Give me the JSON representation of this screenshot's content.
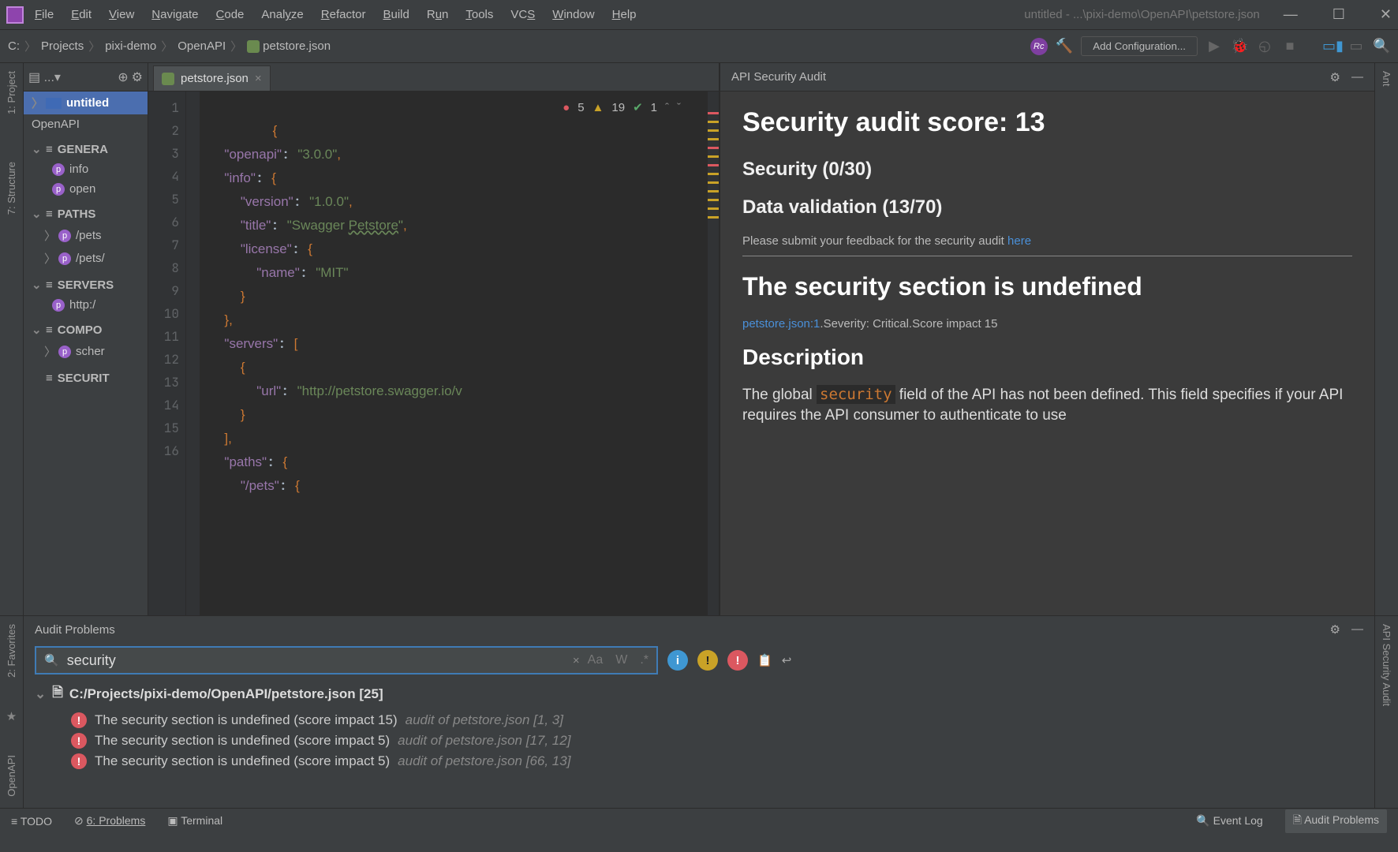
{
  "window": {
    "title": "untitled - ...\\pixi-demo\\OpenAPI\\petstore.json"
  },
  "menu": [
    "File",
    "Edit",
    "View",
    "Navigate",
    "Code",
    "Analyze",
    "Refactor",
    "Build",
    "Run",
    "Tools",
    "VCS",
    "Window",
    "Help"
  ],
  "breadcrumb": [
    "C:",
    "Projects",
    "pixi-demo",
    "OpenAPI",
    "petstore.json"
  ],
  "toolbar": {
    "config_label": "Add Configuration..."
  },
  "leftstrips": {
    "project": "1: Project",
    "structure": "7: Structure",
    "favorites": "2: Favorites",
    "openapi": "OpenAPI"
  },
  "rightstrips": {
    "ant": "Ant",
    "audit": "API Security Audit"
  },
  "tree": {
    "root": "untitled",
    "group1": "OpenAPI",
    "sections": {
      "general": {
        "label": "GENERA",
        "items": [
          "info",
          "open"
        ]
      },
      "paths": {
        "label": "PATHS",
        "items": [
          "/pets",
          "/pets/"
        ]
      },
      "servers": {
        "label": "SERVERS",
        "items": [
          "http:/"
        ]
      },
      "components": {
        "label": "COMPO",
        "items": [
          "scher"
        ]
      },
      "security": {
        "label": "SECURIT"
      }
    }
  },
  "tab": {
    "name": "petstore.json"
  },
  "code": {
    "counts": {
      "errors": "5",
      "warnings": "19",
      "ok": "1"
    },
    "lines": [
      "{",
      "  \"openapi\": \"3.0.0\",",
      "  \"info\": {",
      "    \"version\": \"1.0.0\",",
      "    \"title\": \"Swagger Petstore\",",
      "    \"license\": {",
      "      \"name\": \"MIT\"",
      "    }",
      "  },",
      "  \"servers\": [",
      "    {",
      "      \"url\": \"http://petstore.swagger.io/v",
      "    }",
      "  ],",
      "  \"paths\": {",
      "    \"/pets\": {"
    ]
  },
  "audit": {
    "title": "API Security Audit",
    "score_label": "Security audit score: 13",
    "security_label": "Security (0/30)",
    "datavalid_label": "Data validation (13/70)",
    "feedback_pre": "Please submit your feedback for the security audit ",
    "feedback_link": "here",
    "issue_title": "The security section is undefined",
    "meta_file": "petstore.json:1",
    "meta_rest": ".Severity: Critical.Score impact 15",
    "desc_h": "Description",
    "desc_p1": "The global ",
    "desc_code": "security",
    "desc_p2": " field of the API has not been defined. This field specifies if your API requires the API consumer to authenticate to use"
  },
  "problems": {
    "title": "Audit Problems",
    "search_value": "security",
    "file_line": "C:/Projects/pixi-demo/OpenAPI/petstore.json [25]",
    "issues": [
      {
        "text": "The security section is undefined (score impact 15)",
        "loc": "audit of petstore.json [1, 3]"
      },
      {
        "text": "The security section is undefined (score impact 5)",
        "loc": "audit of petstore.json [17, 12]"
      },
      {
        "text": "The security section is undefined (score impact 5)",
        "loc": "audit of petstore.json [66, 13]"
      }
    ]
  },
  "status": {
    "todo": "TODO",
    "problems": "6: Problems",
    "terminal": "Terminal",
    "eventlog": "Event Log",
    "audit": "Audit Problems"
  }
}
